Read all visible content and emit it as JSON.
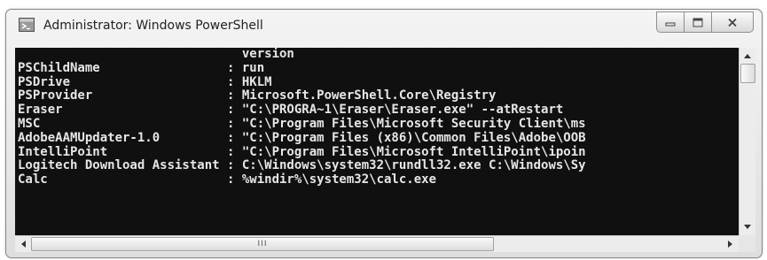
{
  "window": {
    "title": "Administrator: Windows PowerShell",
    "icon": "powershell-icon"
  },
  "caption_buttons": {
    "minimize_icon": "minimize-icon",
    "maximize_icon": "maximize-icon",
    "close_icon": "close-icon"
  },
  "console": {
    "lines": [
      "                              version",
      "PSChildName                 : run",
      "PSDrive                     : HKLM",
      "PSProvider                  : Microsoft.PowerShell.Core\\Registry",
      "Eraser                      : \"C:\\PROGRA~1\\Eraser\\Eraser.exe\" --atRestart",
      "MSC                         : \"C:\\Program Files\\Microsoft Security Client\\ms",
      "AdobeAAMUpdater-1.0         : \"C:\\Program Files (x86)\\Common Files\\Adobe\\OOB",
      "IntelliPoint                : \"C:\\Program Files\\Microsoft IntelliPoint\\ipoin",
      "Logitech Download Assistant : C:\\Windows\\system32\\rundll32.exe C:\\Windows\\Sy",
      "Calc                        : %windir%\\system32\\calc.exe"
    ],
    "background_color": "#101010",
    "text_color": "#e6e6e6"
  },
  "scrollbars": {
    "horizontal_grip": "III"
  }
}
